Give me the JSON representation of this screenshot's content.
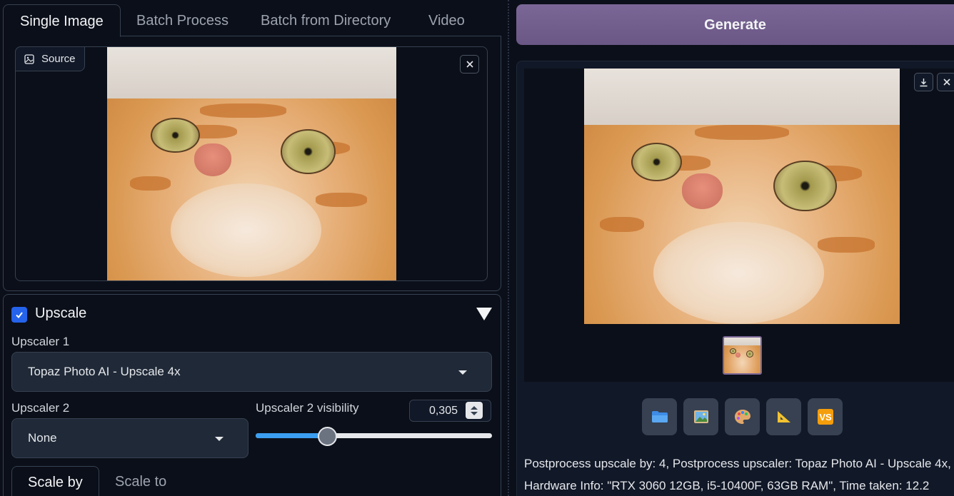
{
  "tabs": [
    "Single Image",
    "Batch Process",
    "Batch from Directory",
    "Video"
  ],
  "source": {
    "label": "Source"
  },
  "upscale": {
    "title": "Upscale",
    "checked": true,
    "upscaler1_label": "Upscaler 1",
    "upscaler1_value": "Topaz Photo AI - Upscale 4x",
    "upscaler2_label": "Upscaler 2",
    "upscaler2_value": "None",
    "visibility_label": "Upscaler 2 visibility",
    "visibility_value": "0,305",
    "visibility_fraction": 0.305,
    "scale_tabs": [
      "Scale by",
      "Scale to"
    ]
  },
  "generate_label": "Generate",
  "actions": [
    "folder-icon",
    "image-icon",
    "palette-icon",
    "triangle-ruler-icon",
    "vs-icon"
  ],
  "info": "Postprocess upscale by: 4, Postprocess upscaler: Topaz Photo AI - Upscale 4x, Hardware Info: \"RTX 3060 12GB, i5-10400F, 63GB RAM\", Time taken: 12.2",
  "colors": {
    "accent": "#6a5785",
    "checkbox": "#2563eb",
    "slider": "#3b9ef0"
  }
}
